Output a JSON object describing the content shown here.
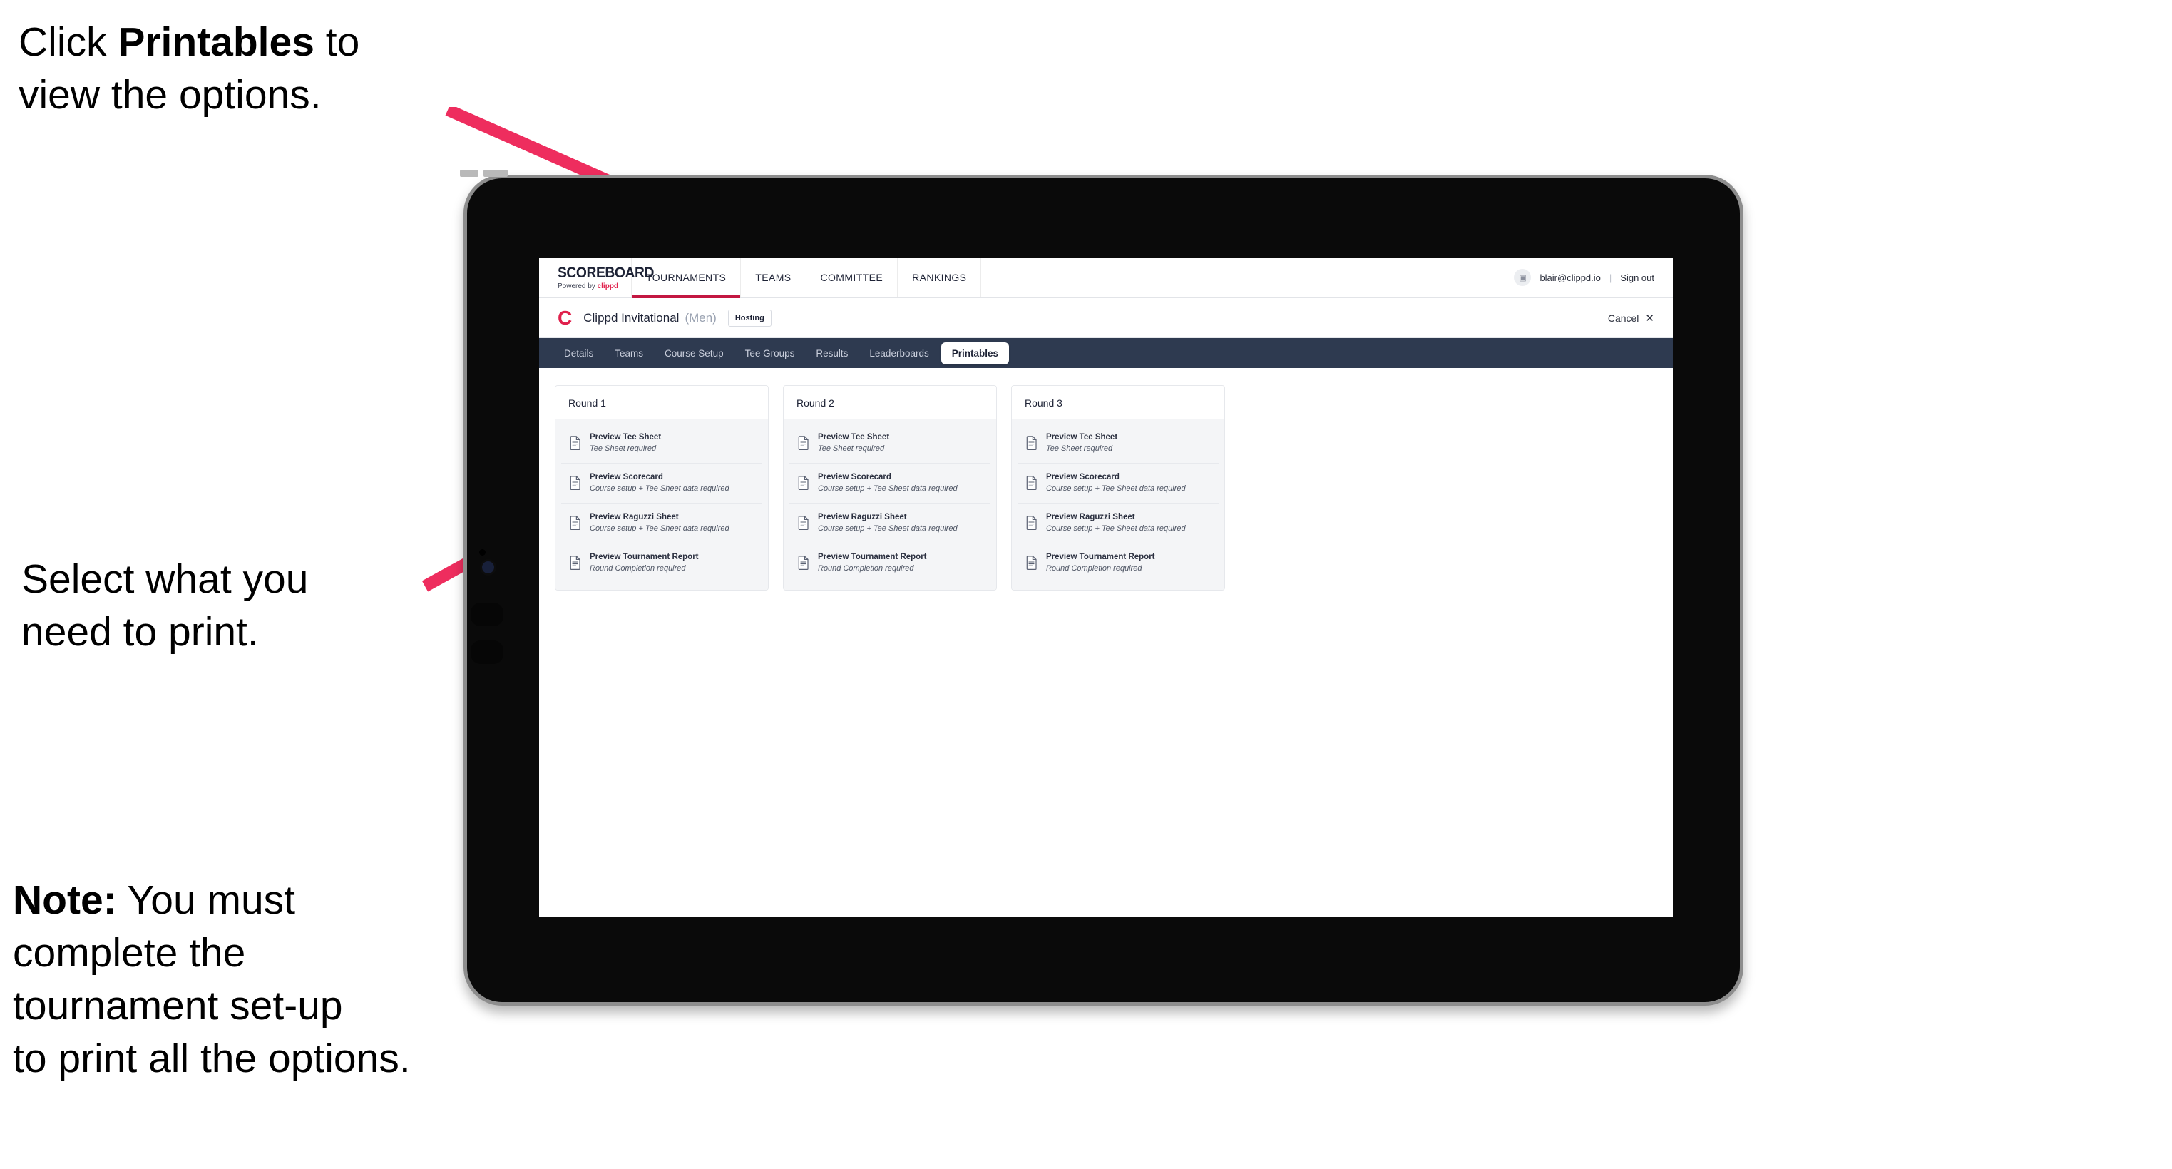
{
  "annotations": {
    "top": {
      "prefix": "Click ",
      "bold": "Printables",
      "suffix": " to\nview the options."
    },
    "middle": {
      "text": "Select what you\n need to print."
    },
    "note": {
      "bold": "Note:",
      "text": " You must\ncomplete the\ntournament set-up\nto print all the options."
    }
  },
  "colors": {
    "accent_pink": "#EE2D5E",
    "brand_red": "#E0214C",
    "nav_underline": "#C31741",
    "tab_strip": "#2E3A50"
  },
  "app": {
    "brand": {
      "title": "SCOREBOARD",
      "powered_prefix": "Powered by ",
      "powered_brand": "clippd"
    },
    "main_nav": [
      {
        "label": "TOURNAMENTS",
        "active": true
      },
      {
        "label": "TEAMS",
        "active": false
      },
      {
        "label": "COMMITTEE",
        "active": false
      },
      {
        "label": "RANKINGS",
        "active": false
      }
    ],
    "header_right": {
      "avatar_glyph": "▣",
      "email": "blair@clippd.io",
      "separator": "|",
      "signout": "Sign out"
    },
    "sub_header": {
      "logo_letter": "C",
      "tournament_name": "Clippd Invitational",
      "gender": "(Men)",
      "status_badge": "Hosting",
      "cancel_label": "Cancel",
      "cancel_icon": "✕"
    },
    "tabs": [
      {
        "label": "Details",
        "active": false
      },
      {
        "label": "Teams",
        "active": false
      },
      {
        "label": "Course Setup",
        "active": false
      },
      {
        "label": "Tee Groups",
        "active": false
      },
      {
        "label": "Results",
        "active": false
      },
      {
        "label": "Leaderboards",
        "active": false
      },
      {
        "label": "Printables",
        "active": true
      }
    ],
    "rounds": [
      {
        "heading": "Round 1",
        "items": [
          {
            "title": "Preview Tee Sheet",
            "requirement": "Tee Sheet required"
          },
          {
            "title": "Preview Scorecard",
            "requirement": "Course setup + Tee Sheet data required"
          },
          {
            "title": "Preview Raguzzi Sheet",
            "requirement": "Course setup + Tee Sheet data required"
          },
          {
            "title": "Preview Tournament Report",
            "requirement": "Round Completion required"
          }
        ]
      },
      {
        "heading": "Round 2",
        "items": [
          {
            "title": "Preview Tee Sheet",
            "requirement": "Tee Sheet required"
          },
          {
            "title": "Preview Scorecard",
            "requirement": "Course setup + Tee Sheet data required"
          },
          {
            "title": "Preview Raguzzi Sheet",
            "requirement": "Course setup + Tee Sheet data required"
          },
          {
            "title": "Preview Tournament Report",
            "requirement": "Round Completion required"
          }
        ]
      },
      {
        "heading": "Round 3",
        "items": [
          {
            "title": "Preview Tee Sheet",
            "requirement": "Tee Sheet required"
          },
          {
            "title": "Preview Scorecard",
            "requirement": "Course setup + Tee Sheet data required"
          },
          {
            "title": "Preview Raguzzi Sheet",
            "requirement": "Course setup + Tee Sheet data required"
          },
          {
            "title": "Preview Tournament Report",
            "requirement": "Round Completion required"
          }
        ]
      }
    ]
  }
}
